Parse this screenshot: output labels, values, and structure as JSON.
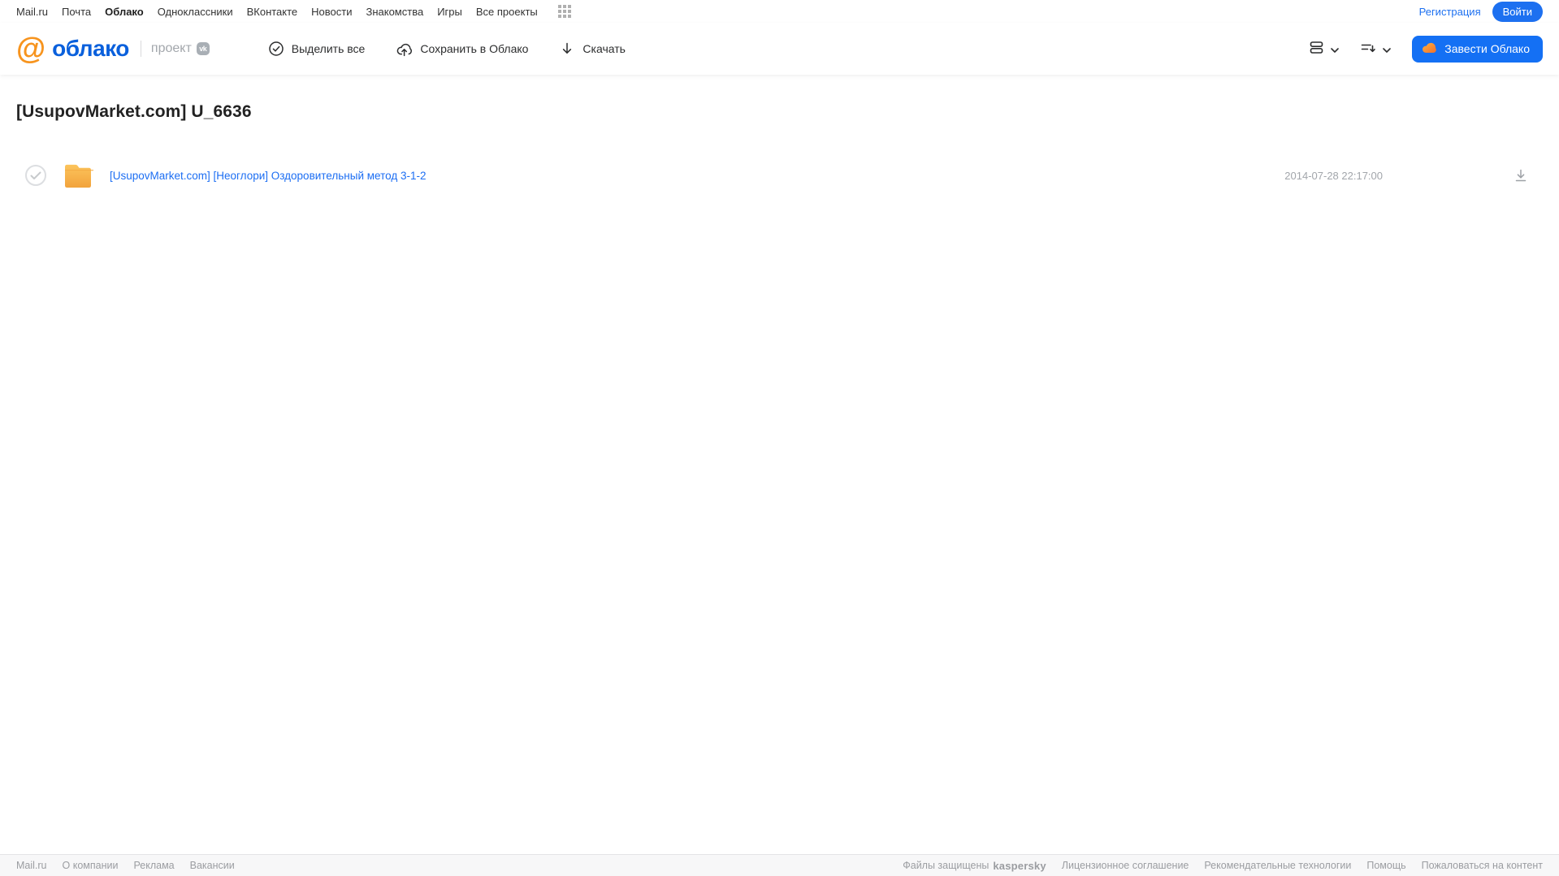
{
  "topnav": {
    "items": [
      "Mail.ru",
      "Почта",
      "Облако",
      "Одноклассники",
      "ВКонтакте",
      "Новости",
      "Знакомства",
      "Игры",
      "Все проекты"
    ],
    "active_item": "Облако",
    "registration": "Регистрация",
    "login": "Войти"
  },
  "header": {
    "logo": {
      "at": "@",
      "name": "облако",
      "project": "проект",
      "vk": "vk"
    },
    "toolbar": {
      "select_all": "Выделить все",
      "save_to_cloud": "Сохранить в Облако",
      "download": "Скачать"
    },
    "cta": "Завести Облако"
  },
  "main": {
    "title": "[UsupovMarket.com] U_6636",
    "files": [
      {
        "type": "folder",
        "name": "[UsupovMarket.com] [Неоглори] Оздоровительный метод 3-1-2",
        "date": "2014-07-28 22:17:00"
      }
    ]
  },
  "footer": {
    "left": [
      "Mail.ru",
      "О компании",
      "Реклама",
      "Вакансии"
    ],
    "protected_label": "Файлы защищены",
    "kaspersky": "kaspersky",
    "right": [
      "Лицензионное соглашение",
      "Рекомендательные технологии",
      "Помощь",
      "Пожаловаться на контент"
    ]
  },
  "colors": {
    "accent_blue": "#1d70f0",
    "logo_blue": "#0a60dc",
    "logo_orange": "#f7941e",
    "folder_orange": "#f5a93b",
    "kaspersky_green": "#00846e",
    "footer_bg": "#f7f7f8"
  }
}
